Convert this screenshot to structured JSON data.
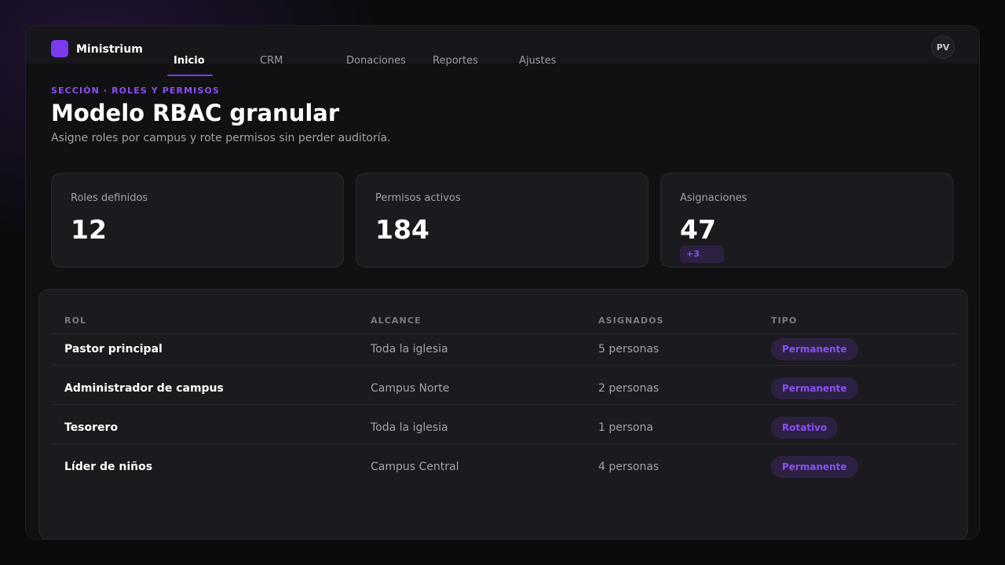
{
  "brand": {
    "name": "Ministrium"
  },
  "nav": {
    "tabs": [
      {
        "label": "Inicio",
        "active": true
      },
      {
        "label": "CRM",
        "active": false
      },
      {
        "label": "Donaciones",
        "active": false
      },
      {
        "label": "Reportes",
        "active": false
      },
      {
        "label": "Ajustes",
        "active": false
      }
    ]
  },
  "user": {
    "initials": "PV"
  },
  "page": {
    "eyebrow": "SECCIÓN · ROLES Y PERMISOS",
    "title": "Modelo RBAC granular",
    "subtitle": "Asigne roles por campus y rote permisos sin perder auditoría."
  },
  "stats": [
    {
      "label": "Roles definidos",
      "value": "12"
    },
    {
      "label": "Permisos activos",
      "value": "184"
    },
    {
      "label": "Asignaciones",
      "value": "47",
      "badge": "+3"
    }
  ],
  "table": {
    "headers": [
      "ROL",
      "ALCANCE",
      "ASIGNADOS",
      "TIPO"
    ],
    "rows": [
      {
        "role": "Pastor principal",
        "scope": "Toda la iglesia",
        "assigned": "5 personas",
        "type": "Permanente"
      },
      {
        "role": "Administrador de campus",
        "scope": "Campus Norte",
        "assigned": "2 personas",
        "type": "Permanente"
      },
      {
        "role": "Tesorero",
        "scope": "Toda la iglesia",
        "assigned": "1 persona",
        "type": "Rotativo"
      },
      {
        "role": "Líder de niños",
        "scope": "Campus Central",
        "assigned": "4 personas",
        "type": "Permanente"
      }
    ]
  },
  "colors": {
    "accent": "#7c3aed",
    "accent_text": "#8b4ff0",
    "pill_bg": "#2c2142"
  }
}
